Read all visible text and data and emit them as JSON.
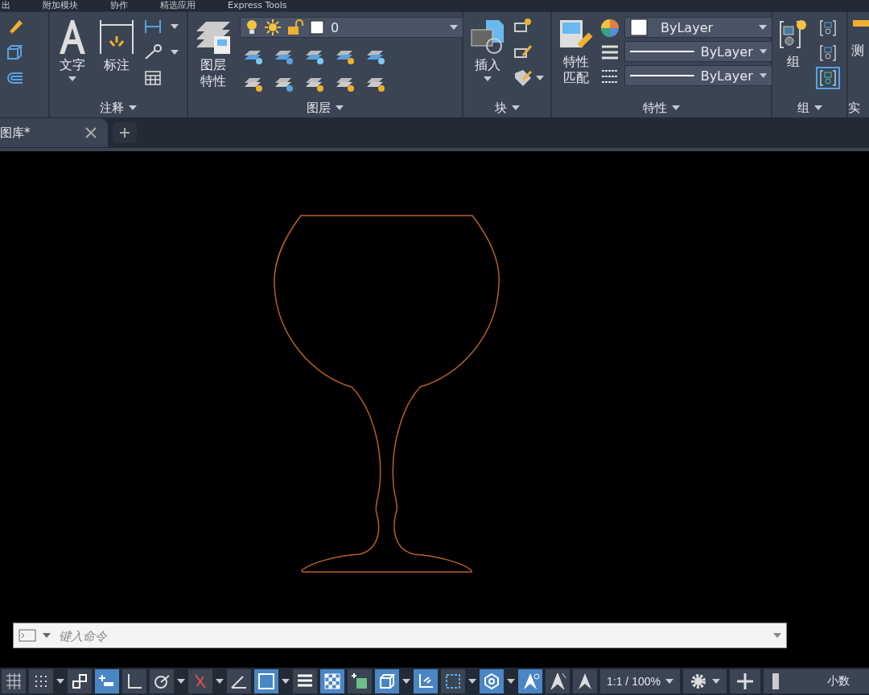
{
  "menu_bar": [
    "出",
    "附加模块",
    "协作",
    "精选应用",
    "Express Tools"
  ],
  "ribbon": {
    "annotation": {
      "title": "注释",
      "text_button": "文字",
      "dimension_button": "标注"
    },
    "layers": {
      "title": "图层",
      "properties_button": [
        "图层",
        "特性"
      ],
      "current_layer": "0"
    },
    "block": {
      "title": "块",
      "insert_button": "插入"
    },
    "properties": {
      "title": "特性",
      "match_button": [
        "特性",
        "匹配"
      ],
      "color_value": "ByLayer",
      "linetype": "ByLayer",
      "lineweight": "ByLayer"
    },
    "group": {
      "title": "组",
      "group_button": "组",
      "tools": [
        {
          "selected": false
        },
        {
          "selected": false
        },
        {
          "selected": true
        }
      ]
    },
    "utilities": {
      "title": "实",
      "measure_button": "测"
    }
  },
  "tabs": [
    {
      "label": "图库*",
      "selected": true
    }
  ],
  "command_line": {
    "placeholder": "键入命令"
  },
  "status_bar": {
    "toggles": [
      {
        "kind": "toggle",
        "on": false,
        "caret": false
      },
      {
        "kind": "toggle",
        "on": false,
        "caret": true
      },
      {
        "kind": "toggle",
        "on": false,
        "caret": false
      },
      {
        "kind": "toggle",
        "on": true,
        "caret": false
      },
      {
        "kind": "toggle",
        "on": false,
        "caret": false
      },
      {
        "kind": "toggle",
        "on": false,
        "caret": true
      },
      {
        "kind": "toggle",
        "on": false,
        "caret": true
      },
      {
        "kind": "toggle",
        "on": false,
        "caret": false
      },
      {
        "kind": "toggle",
        "on": true,
        "caret": true
      },
      {
        "kind": "toggle",
        "on": false,
        "caret": false
      },
      {
        "kind": "toggle",
        "on": true,
        "caret": false
      },
      {
        "kind": "toggle",
        "on": false,
        "caret": false
      },
      {
        "kind": "toggle",
        "on": true,
        "caret": true
      },
      {
        "kind": "toggle",
        "on": true,
        "caret": false
      },
      {
        "kind": "toggle",
        "on": false,
        "caret": true
      },
      {
        "kind": "toggle",
        "on": true,
        "caret": true
      },
      {
        "kind": "toggle",
        "on": true,
        "caret": false
      },
      {
        "kind": "toggle",
        "on": false,
        "caret": false
      },
      {
        "kind": "toggle",
        "on": false,
        "caret": false
      }
    ],
    "scale": "1:1 / 100%",
    "units": "小数"
  }
}
